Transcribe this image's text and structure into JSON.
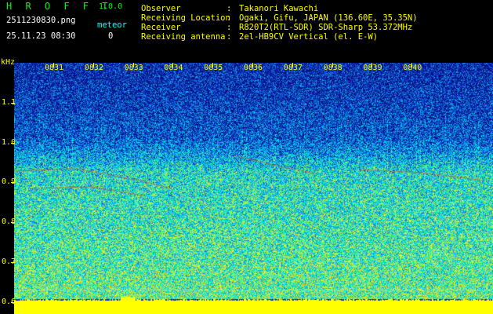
{
  "header": {
    "app_title": "H R O F F T",
    "app_version": "1.0.0",
    "filename": "2511230830.png",
    "datetime": "25.11.23 08:30",
    "meteor_label": "meteor",
    "meteor_count": "0",
    "fields": [
      {
        "label": "Observer",
        "sep": ":",
        "value": "Takanori Kawachi"
      },
      {
        "label": "Receiving Location",
        "sep": ":",
        "value": "Ogaki, Gifu, JAPAN (136.60E, 35.35N)"
      },
      {
        "label": "Receiver",
        "sep": ":",
        "value": "R820T2(RTL-SDR) SDR-Sharp 53.372MHz"
      },
      {
        "label": "Receiving antenna",
        "sep": ":",
        "value": "2el-HB9CV Vertical (el. E-W)"
      }
    ]
  },
  "spectrogram": {
    "y_unit": "kHz",
    "y_ticks": [
      "1.1",
      "1.0",
      "0.9",
      "0.8",
      "0.7",
      "0.6"
    ],
    "y_range_khz": [
      0.57,
      1.2
    ],
    "x_ticks": [
      "0831",
      "0832",
      "0833",
      "0834",
      "0835",
      "0836",
      "0837",
      "0838",
      "0839",
      "0840"
    ],
    "colors": {
      "background": "#0a1a8c",
      "noise_high": "#00ffff",
      "signal": "#ff3000",
      "baseline": "#ffff00",
      "axis": "#ffff00"
    }
  }
}
